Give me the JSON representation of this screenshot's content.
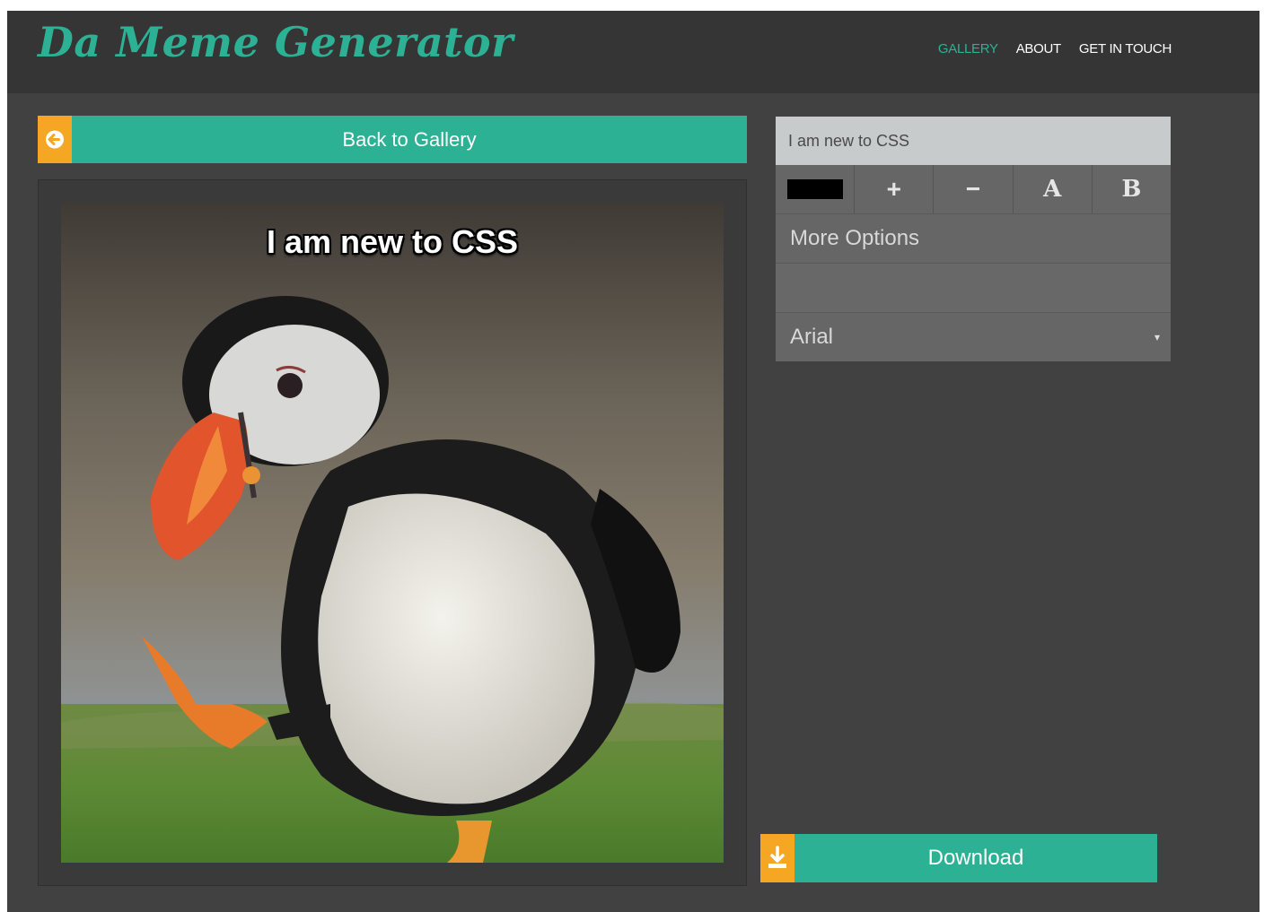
{
  "header": {
    "logo": "Da Meme Generator",
    "nav": [
      {
        "label": "GALLERY",
        "active": true
      },
      {
        "label": "ABOUT",
        "active": false
      },
      {
        "label": "GET IN TOUCH",
        "active": false
      }
    ]
  },
  "editor": {
    "back_label": "Back to Gallery",
    "back_icon": "arrow-left-icon",
    "meme_caption": "I am new to CSS",
    "meme_image": "puffin photo"
  },
  "controls": {
    "text_value": "I am new to CSS",
    "text_color": "#000000",
    "increase_size_icon": "plus-icon",
    "decrease_size_icon": "minus-icon",
    "font_style_a": "A",
    "font_style_b": "B",
    "more_options_label": "More Options",
    "font_select_value": "Arial",
    "select_arrow": "▾"
  },
  "download": {
    "label": "Download",
    "icon": "download-icon"
  },
  "colors": {
    "accent": "#2db194",
    "icon_box": "#f5a623",
    "header_bg": "#353535",
    "page_bg": "#414141"
  }
}
